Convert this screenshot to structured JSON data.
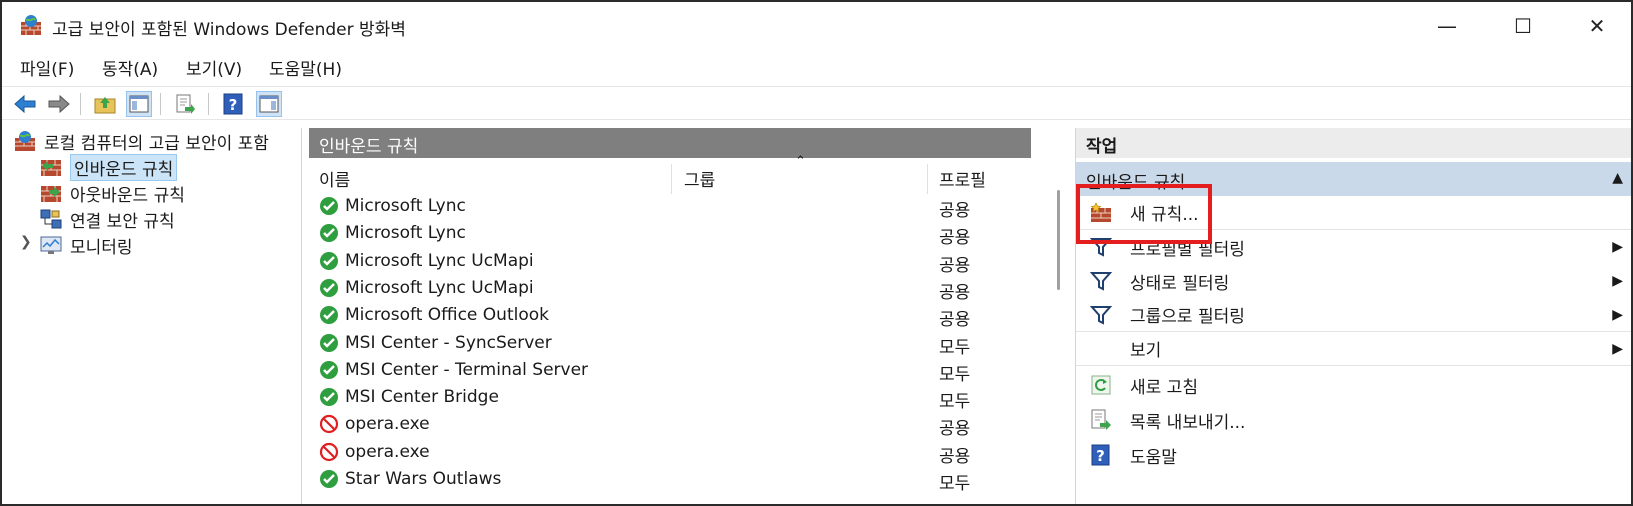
{
  "window": {
    "title": "고급 보안이 포함된 Windows Defender 방화벽",
    "controls": {
      "minimize": "—",
      "maximize": "☐",
      "close": "✕"
    }
  },
  "menu": [
    "파일(F)",
    "동작(A)",
    "보기(V)",
    "도움말(H)"
  ],
  "tree": {
    "root": "로컬 컴퓨터의 고급 보안이 포함",
    "items": [
      "인바운드 규칙",
      "아웃바운드 규칙",
      "연결 보안 규칙",
      "모니터링"
    ]
  },
  "center": {
    "header": "인바운드 규칙",
    "columns": {
      "name": "이름",
      "group": "그룹",
      "profile": "프로필"
    },
    "rows": [
      {
        "name": "Microsoft Lync",
        "profile": "공용",
        "status": "allow"
      },
      {
        "name": "Microsoft Lync",
        "profile": "공용",
        "status": "allow"
      },
      {
        "name": "Microsoft Lync UcMapi",
        "profile": "공용",
        "status": "allow"
      },
      {
        "name": "Microsoft Lync UcMapi",
        "profile": "공용",
        "status": "allow"
      },
      {
        "name": "Microsoft Office Outlook",
        "profile": "공용",
        "status": "allow"
      },
      {
        "name": "MSI Center - SyncServer",
        "profile": "모두",
        "status": "allow"
      },
      {
        "name": "MSI Center - Terminal Server",
        "profile": "모두",
        "status": "allow"
      },
      {
        "name": "MSI Center Bridge",
        "profile": "모두",
        "status": "allow"
      },
      {
        "name": "opera.exe",
        "profile": "공용",
        "status": "block"
      },
      {
        "name": "opera.exe",
        "profile": "공용",
        "status": "block"
      },
      {
        "name": "Star Wars Outlaws",
        "profile": "모두",
        "status": "allow"
      }
    ]
  },
  "actions": {
    "header": "작업",
    "section": "인바운드 규칙",
    "items": [
      {
        "label": "새 규칙...",
        "icon": "new-rule-icon",
        "submenu": false
      },
      {
        "label": "프로필별 필터링",
        "icon": "filter-icon",
        "submenu": true
      },
      {
        "label": "상태로 필터링",
        "icon": "filter-icon",
        "submenu": true
      },
      {
        "label": "그룹으로 필터링",
        "icon": "filter-icon",
        "submenu": true
      },
      {
        "label": "보기",
        "icon": "",
        "submenu": true
      },
      {
        "label": "새로 고침",
        "icon": "refresh-icon",
        "submenu": false
      },
      {
        "label": "목록 내보내기...",
        "icon": "export-icon",
        "submenu": false
      },
      {
        "label": "도움말",
        "icon": "help-icon",
        "submenu": false
      }
    ]
  },
  "colors": {
    "highlight": "#e41e1e",
    "selection": "#cce4f7",
    "pane_header": "#7f7f7f",
    "section": "#cad9ea"
  }
}
